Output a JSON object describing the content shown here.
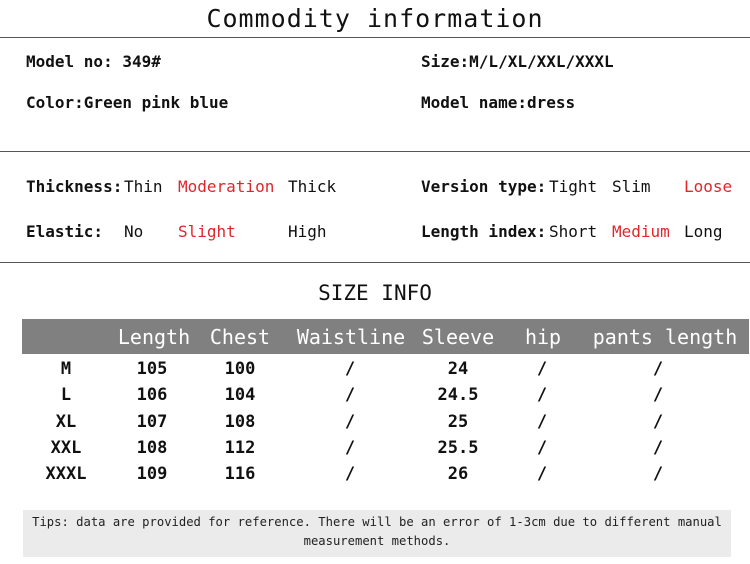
{
  "title": "Commodity information",
  "info": {
    "model_no": "Model no: 349#",
    "size": "Size:M/L/XL/XXL/XXXL",
    "color": "Color:Green pink blue",
    "model_name": "Model name:dress"
  },
  "attributes": {
    "thickness": {
      "label": "Thickness:",
      "options": [
        "Thin",
        "Moderation",
        "Thick"
      ],
      "selected": "Moderation"
    },
    "version": {
      "label": "Version type:",
      "options": [
        "Tight",
        "Slim",
        "Loose"
      ],
      "selected": "Loose"
    },
    "elastic": {
      "label": "Elastic:",
      "options": [
        "No",
        "Slight",
        "High"
      ],
      "selected": "Slight"
    },
    "length_index": {
      "label": "Length index:",
      "options": [
        "Short",
        "Medium",
        "Long"
      ],
      "selected": "Medium"
    }
  },
  "size_table": {
    "title": "SIZE INFO",
    "headers": [
      "",
      "Length",
      "Chest",
      "Waistline",
      "Sleeve",
      "hip",
      "pants length"
    ],
    "rows": [
      [
        "M",
        "105",
        "100",
        "/",
        "24",
        "/",
        "/"
      ],
      [
        "L",
        "106",
        "104",
        "/",
        "24.5",
        "/",
        "/"
      ],
      [
        "XL",
        "107",
        "108",
        "/",
        "25",
        "/",
        "/"
      ],
      [
        "XXL",
        "108",
        "112",
        "/",
        "25.5",
        "/",
        "/"
      ],
      [
        "XXXL",
        "109",
        "116",
        "/",
        "26",
        "/",
        "/"
      ]
    ]
  },
  "tips": {
    "line1": "Tips: data are provided for reference. There will be an error of 1-3cm due to different manual",
    "line2": "measurement methods."
  },
  "colors": {
    "highlight": "#e0262b",
    "header_bg": "#808080",
    "tips_bg": "#ebebeb"
  }
}
